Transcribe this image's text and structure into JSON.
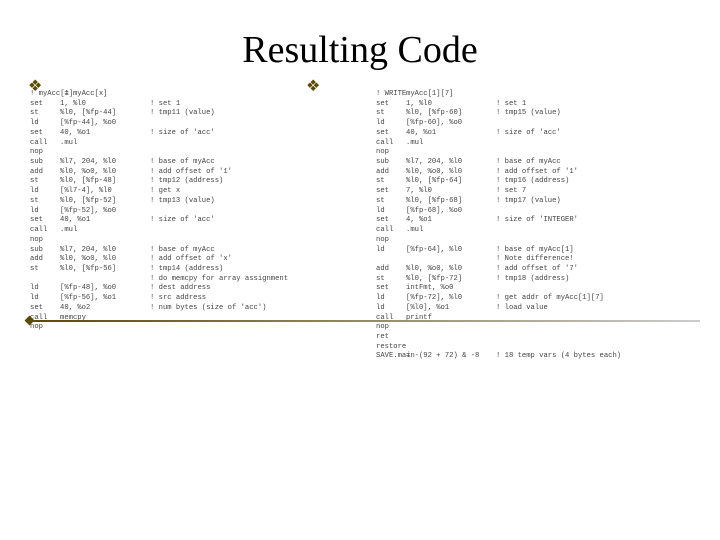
{
  "title": "Resulting Code",
  "left": [
    {
      "a": "! myAcc[1]",
      "b": " = myAcc[x]",
      "c": ""
    },
    {
      "a": "set",
      "b": "1, %l0",
      "c": "! set 1"
    },
    {
      "a": "st",
      "b": "%l0, [%fp-44]",
      "c": "! tmp11 (value)"
    },
    {
      "a": "ld",
      "b": "[%fp-44], %o0",
      "c": ""
    },
    {
      "a": "set",
      "b": "40, %o1",
      "c": "! size of 'acc'"
    },
    {
      "a": "call",
      "b": ".mul",
      "c": ""
    },
    {
      "a": "nop",
      "b": "",
      "c": ""
    },
    {
      "a": "sub",
      "b": "%l7, 204, %l0",
      "c": "! base of myAcc"
    },
    {
      "a": "add",
      "b": "%l0, %o0, %l0",
      "c": "! add offset of '1'"
    },
    {
      "a": "st",
      "b": "%l0, [%fp-48]",
      "c": "! tmp12 (address)"
    },
    {
      "a": "ld",
      "b": "[%l7-4], %l0",
      "c": "! get x"
    },
    {
      "a": "st",
      "b": "%l0, [%fp-52]",
      "c": "! tmp13 (value)"
    },
    {
      "a": "ld",
      "b": "[%fp-52], %o0",
      "c": ""
    },
    {
      "a": "set",
      "b": "40, %o1",
      "c": "! size of 'acc'"
    },
    {
      "a": "call",
      "b": ".mul",
      "c": ""
    },
    {
      "a": "nop",
      "b": "",
      "c": ""
    },
    {
      "a": "sub",
      "b": "%l7, 204, %l0",
      "c": "! base of myAcc"
    },
    {
      "a": "add",
      "b": "%l0, %o0, %l0",
      "c": "! add offset of 'x'"
    },
    {
      "a": "st",
      "b": "%l0, [%fp-56]",
      "c": "! tmp14 (address)"
    },
    {
      "a": "",
      "b": "",
      "c": "! do memcpy for array assignment"
    },
    {
      "a": "ld",
      "b": "[%fp-48], %o0",
      "c": "! dest address"
    },
    {
      "a": "ld",
      "b": "[%fp-56], %o1",
      "c": "! src address"
    },
    {
      "a": "set",
      "b": "40, %o2",
      "c": "! num bytes (size of 'acc')"
    },
    {
      "a": "call",
      "b": "memcpy",
      "c": ""
    },
    {
      "a": "nop",
      "b": "",
      "c": ""
    }
  ],
  "right": [
    {
      "a": "! WRITE",
      "b": "myAcc[1][7]",
      "c": ""
    },
    {
      "a": "set",
      "b": "1, %l0",
      "c": "! set 1"
    },
    {
      "a": "st",
      "b": "%l0, [%fp-60]",
      "c": "! tmp15 (value)"
    },
    {
      "a": "ld",
      "b": "[%fp-60], %o0",
      "c": ""
    },
    {
      "a": "set",
      "b": "40, %o1",
      "c": "! size of 'acc'"
    },
    {
      "a": "call",
      "b": ".mul",
      "c": ""
    },
    {
      "a": "nop",
      "b": "",
      "c": ""
    },
    {
      "a": "sub",
      "b": "%l7, 204, %l0",
      "c": "! base of myAcc"
    },
    {
      "a": "add",
      "b": "%l0, %o0, %l0",
      "c": "! add offset of '1'"
    },
    {
      "a": "st",
      "b": "%l0, [%fp-64]",
      "c": "! tmp16 (address)"
    },
    {
      "a": "set",
      "b": "7, %l0",
      "c": "! set 7"
    },
    {
      "a": "st",
      "b": "%l0, [%fp-68]",
      "c": "! tmp17 (value)"
    },
    {
      "a": "ld",
      "b": "[%fp-68], %o0",
      "c": ""
    },
    {
      "a": "set",
      "b": "4, %o1",
      "c": "! size of 'INTEGER'"
    },
    {
      "a": "call",
      "b": ".mul",
      "c": ""
    },
    {
      "a": "nop",
      "b": "",
      "c": ""
    },
    {
      "a": "ld",
      "b": "[%fp-64], %l0",
      "c": "! base of myAcc[1]"
    },
    {
      "a": "",
      "b": "",
      "c": "! Note difference!"
    },
    {
      "a": "add",
      "b": "%l0, %o0, %l0",
      "c": "! add offset of '7'"
    },
    {
      "a": "st",
      "b": "%l0, [%fp-72]",
      "c": "! tmp18 (address)"
    },
    {
      "a": "set",
      "b": "intFmt, %o0",
      "c": ""
    },
    {
      "a": "ld",
      "b": "[%fp-72], %l0",
      "c": "! get addr of myAcc[1][7]"
    },
    {
      "a": "ld",
      "b": "[%l0], %o1",
      "c": "! load value"
    },
    {
      "a": "call",
      "b": "printf",
      "c": ""
    },
    {
      "a": "nop",
      "b": "",
      "c": ""
    },
    {
      "a": "",
      "b": "",
      "c": ""
    },
    {
      "a": "ret",
      "b": "",
      "c": ""
    },
    {
      "a": "restore",
      "b": "",
      "c": ""
    },
    {
      "a": "SAVE.main",
      "b": "= -(92 + 72) & -8",
      "c": "! 18 temp vars (4 bytes each)"
    }
  ]
}
